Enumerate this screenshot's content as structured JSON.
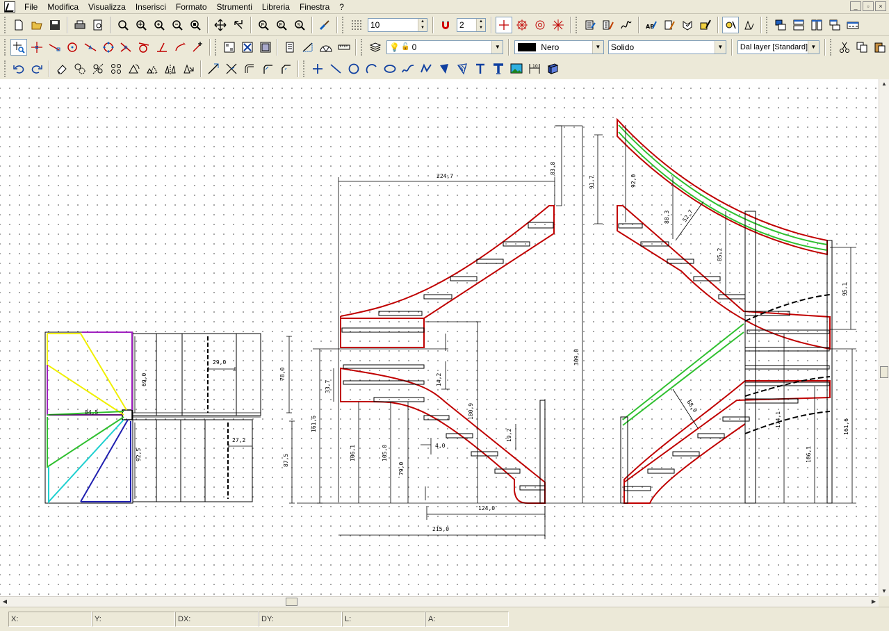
{
  "menu": {
    "items": [
      {
        "label": "File",
        "key": "F"
      },
      {
        "label": "Modifica",
        "key": "M"
      },
      {
        "label": "Visualizza",
        "key": "V"
      },
      {
        "label": "Inserisci",
        "key": "s"
      },
      {
        "label": "Formato",
        "key": "o"
      },
      {
        "label": "Strumenti",
        "key": "S"
      },
      {
        "label": "Libreria",
        "key": "L"
      },
      {
        "label": "Finestra",
        "key": "n"
      },
      {
        "label": "?",
        "key": "?"
      }
    ]
  },
  "window_controls": {
    "minimize": "_",
    "restore": "▫",
    "close": "×"
  },
  "toolbar1": {
    "grid_size": "10",
    "snap_value": "2"
  },
  "toolbar2": {
    "layer_value": "0",
    "color_value": "Nero",
    "linetype_value": "Solido",
    "lineweight_value": "Dal layer [Standard]",
    "color_swatch": "#000000"
  },
  "drawing": {
    "dimensions": {
      "d224": "224,7",
      "d838": "83,8",
      "d917": "91,7",
      "d920": "92,0",
      "d883": "88,3",
      "d527": "52,7",
      "d852": "85,2",
      "d951": "95,1",
      "d309": "309,0",
      "d690": "69,0",
      "d290": "29,0",
      "d780": "78,0",
      "d845": "84,5",
      "d925": "92,5",
      "d272": "27,2",
      "d875": "87,5",
      "d337": "33,7",
      "d142": "14,2",
      "d1616a": "161,6",
      "d1061a": "106,1",
      "d1050": "105,0",
      "d790": "79,0",
      "d1809": "180,9",
      "d192": "19,2",
      "d40": "4,0",
      "d1240": "124,0",
      "d2150": "215,0",
      "d680": "68,0",
      "d1741": "174,1",
      "d1061b": "106,1",
      "d1616b": "161,6"
    },
    "colors": {
      "stair_outline": "#c00000",
      "handrail": "#22cc22",
      "dim_line": "#000000",
      "plan_yellow": "#f0f000",
      "plan_purple": "#a020c0",
      "plan_green": "#30c030",
      "plan_cyan": "#20d0d0",
      "plan_blue": "#2020b0"
    }
  },
  "statusbar": {
    "x_label": "X:",
    "y_label": "Y:",
    "dx_label": "DX:",
    "dy_label": "DY:",
    "l_label": "L:",
    "a_label": "A:"
  }
}
